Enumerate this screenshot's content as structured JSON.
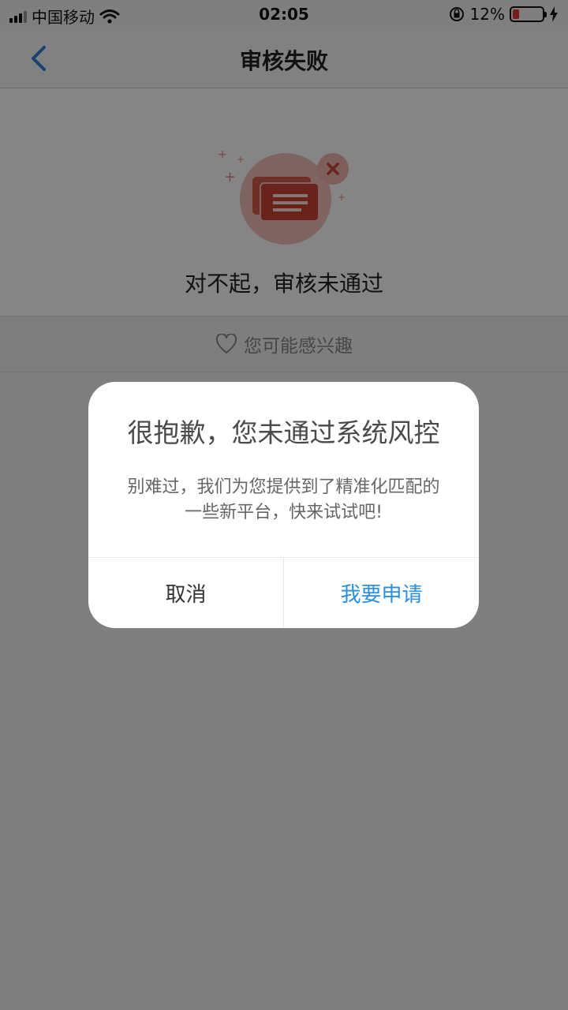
{
  "status_bar": {
    "carrier": "中国移动",
    "time": "02:05",
    "battery_percent": "12%"
  },
  "navbar": {
    "title": "审核失败"
  },
  "hero": {
    "message": "对不起，审核未通过"
  },
  "interest": {
    "label": "您可能感兴趣"
  },
  "dialog": {
    "title": "很抱歉，您未通过系统风控",
    "message_line1": "别难过，我们为您提供到了精准化匹配的",
    "message_line2": "一些新平台，快来试试吧!",
    "cancel_label": "取消",
    "apply_label": "我要申请"
  },
  "colors": {
    "accent": "#2a8fe0",
    "error_red": "#d9503f",
    "battery_low": "#e53935"
  }
}
